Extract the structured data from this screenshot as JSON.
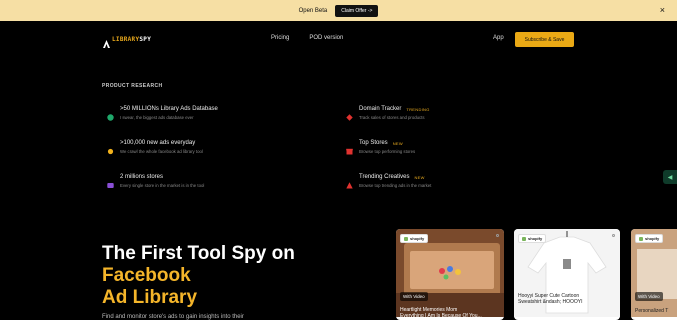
{
  "banner": {
    "text": "Open Beta",
    "claim_label": "Claim Offer ->",
    "close_glyph": "×"
  },
  "nav": {
    "logo_prefix": "AI",
    "logo_library": "LIBRARY",
    "logo_spy": "SPY",
    "links": [
      "Pricing",
      "POD version"
    ],
    "app_label": "App",
    "subscribe_label": "Subscribe & Save"
  },
  "menu": {
    "heading": "PRODUCT RESEARCH",
    "items": [
      {
        "title": ">50 MILLIONs Library Ads Database",
        "desc": "I swear, the biggest ads database ever",
        "badge": "",
        "icon": "database-icon",
        "color": "#1fa86b"
      },
      {
        "title": ">100,000 new ads everyday",
        "desc": "We crawl the whole facebook ad library tool",
        "badge": "",
        "icon": "lightning-icon",
        "color": "#f2b21c"
      },
      {
        "title": "2 millions stores",
        "desc": "Every single store in the market is in the tool",
        "badge": "",
        "icon": "store-icon",
        "color": "#8a4fd6"
      },
      {
        "title": "Domain Tracker",
        "desc": "Track sales of stores and products",
        "badge": "TRENDING",
        "icon": "domain-icon",
        "color": "#e0322f"
      },
      {
        "title": "Top Stores",
        "desc": "Browse top performing stores",
        "badge": "NEW",
        "icon": "top-stores-icon",
        "color": "#e0322f"
      },
      {
        "title": "Trending Creatives",
        "desc": "Browse top trending ads in the market",
        "badge": "NEW",
        "icon": "creatives-icon",
        "color": "#e0322f"
      }
    ]
  },
  "hero": {
    "line1": "The First Tool Spy on",
    "line2": "Facebook",
    "line3": "Ad Library",
    "sub": "Find and monitor store's ads to gain insights into their"
  },
  "cards": [
    {
      "platform": "shopify",
      "tag": "With Video",
      "title": "Heartlight Memories Mom",
      "title2": "Everything I Am Is Because Of You...",
      "image": "shoebox-image"
    },
    {
      "platform": "shopify",
      "tag": "",
      "title": "Hooyyi Super Cute Cartoon",
      "title2": "Sweatshirt &ndash; HOOOYI",
      "image": "sweatshirt-image"
    },
    {
      "platform": "shopify",
      "tag": "With Video",
      "title": "Personalized T",
      "title2": "",
      "image": "product-image"
    }
  ]
}
